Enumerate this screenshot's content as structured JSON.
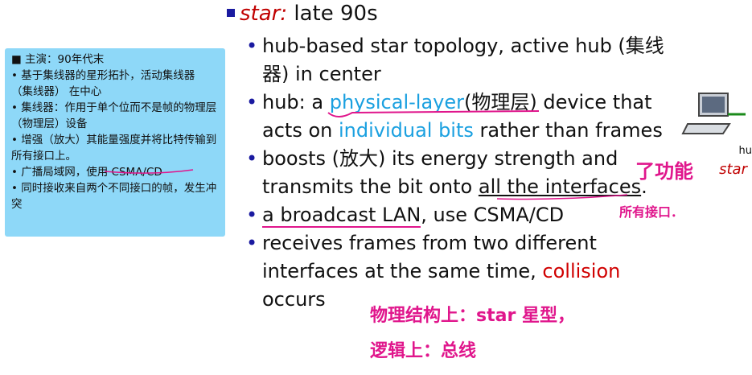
{
  "note": {
    "lines": [
      "■ 主演：90年代末",
      "• 基于集线器的星形拓扑，活动集线器 （集线器） 在中心",
      "• 集线器：作用于单个位而不是帧的物理层（物理层）设备",
      "• 增强（放大）其能量强度并将比特传输到所有接口上。",
      "• 广播局域网，使用 CSMA/CD",
      "• 同时接收来自两个不同接口的帧，发生冲突"
    ]
  },
  "slide": {
    "title_star": "star:",
    "title_rest": " late 90s",
    "bullet1": "hub-based star topology, active hub (集线器) in center",
    "bullet2_a": "hub: a ",
    "bullet2_link": "physical-layer",
    "bullet2_b": "(物理层) device that acts on ",
    "bullet2_link2": "individual bits",
    "bullet2_c": " rather than  frames",
    "bullet3_a": "boosts (放大) its energy strength and transmits the bit onto ",
    "bullet3_u": "all the interfaces",
    "bullet3_end": ".",
    "bullet4_u": "a broadcast LAN",
    "bullet4_rest": ", use CSMA/CD",
    "bullet5_a": "receives frames from two different interfaces at the same time, ",
    "bullet5_red": "collision",
    "bullet5_b": " occurs"
  },
  "handwriting": {
    "func": "了功能",
    "all_ports": "所有接口．",
    "physical": "物理结构上：star 星型，",
    "logical": "逻辑上：总线"
  },
  "side": {
    "hub": "hu",
    "star": "star"
  }
}
